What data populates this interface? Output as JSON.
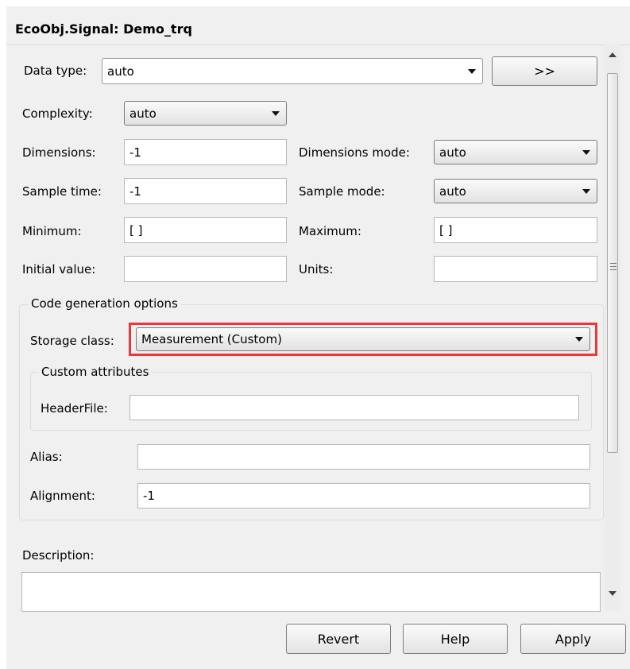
{
  "header": {
    "title": "EcoObj.Signal: Demo_trq"
  },
  "data_type": {
    "label": "Data type:",
    "value": "auto",
    "expand_button_label": ">>"
  },
  "complexity": {
    "label": "Complexity:",
    "value": "auto"
  },
  "dimensions": {
    "label": "Dimensions:",
    "value": "-1"
  },
  "dimensions_mode": {
    "label": "Dimensions mode:",
    "value": "auto"
  },
  "sample_time": {
    "label": "Sample time:",
    "value": "-1"
  },
  "sample_mode": {
    "label": "Sample mode:",
    "value": "auto"
  },
  "minimum": {
    "label": "Minimum:",
    "value": "[ ]"
  },
  "maximum": {
    "label": "Maximum:",
    "value": "[ ]"
  },
  "initial_value": {
    "label": "Initial value:",
    "value": ""
  },
  "units": {
    "label": "Units:",
    "value": ""
  },
  "code_generation": {
    "title": "Code generation options",
    "storage_class": {
      "label": "Storage class:",
      "value": "Measurement (Custom)"
    },
    "custom_attributes": {
      "title": "Custom attributes",
      "header_file": {
        "label": "HeaderFile:",
        "value": ""
      }
    },
    "alias": {
      "label": "Alias:",
      "value": ""
    },
    "alignment": {
      "label": "Alignment:",
      "value": "-1"
    }
  },
  "description": {
    "label": "Description:",
    "value": ""
  },
  "buttons": {
    "revert": "Revert",
    "help": "Help",
    "apply": "Apply"
  },
  "colors": {
    "highlight": "#e8393a",
    "background": "#f0f0f0"
  },
  "scrollbar": {
    "icons": [
      "chevron-up-icon",
      "chevron-down-icon",
      "grip-icon"
    ]
  }
}
